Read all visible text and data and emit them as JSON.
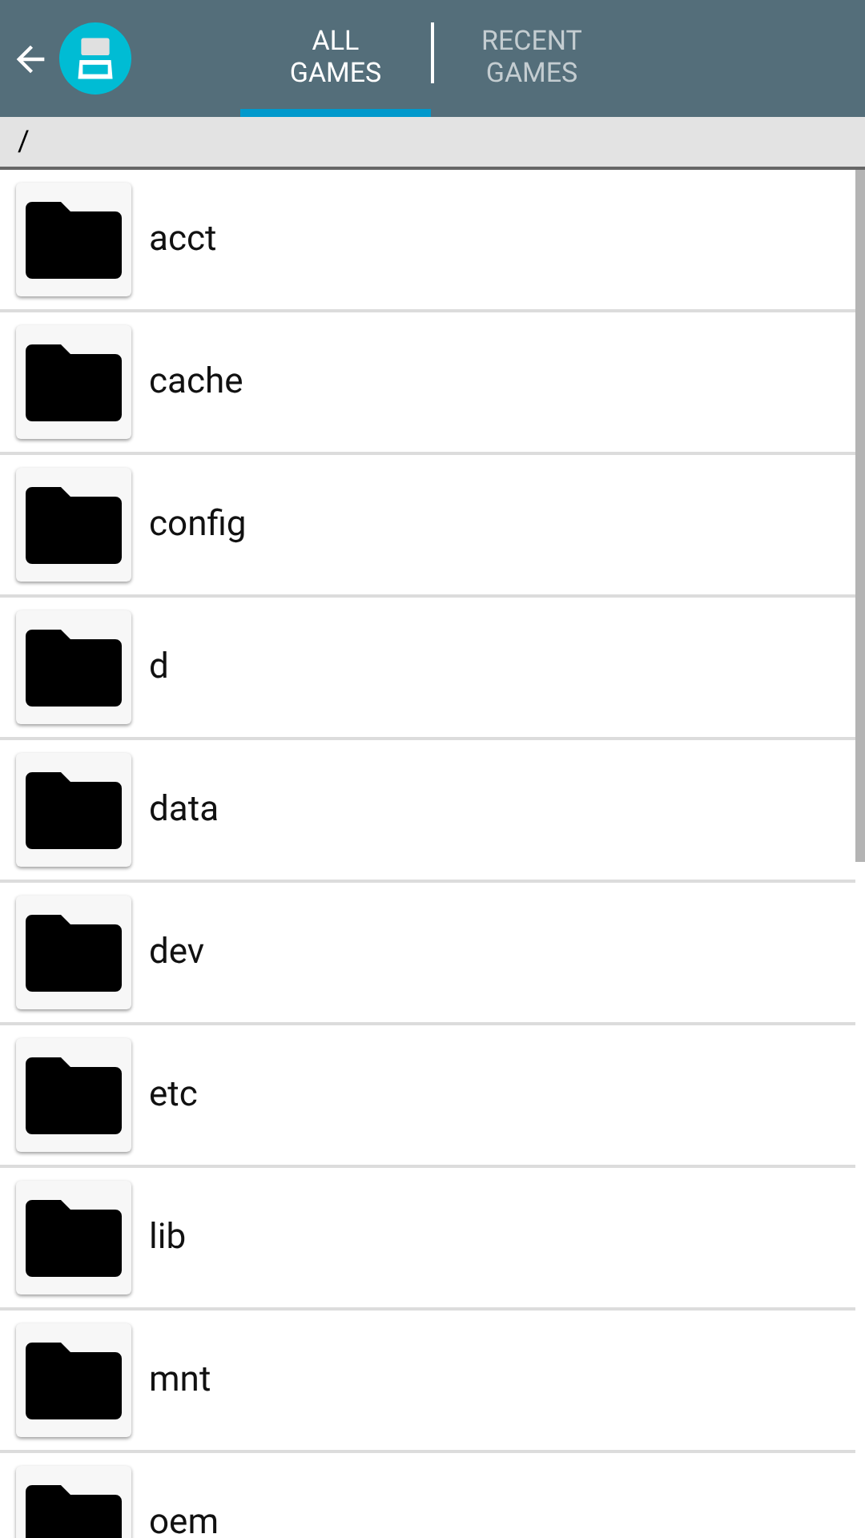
{
  "tabs": [
    {
      "label": "ALL GAMES",
      "selected": true
    },
    {
      "label": "RECENT GAMES",
      "selected": false
    }
  ],
  "path": "/",
  "files": [
    {
      "name": "acct"
    },
    {
      "name": "cache"
    },
    {
      "name": "config"
    },
    {
      "name": "d"
    },
    {
      "name": "data"
    },
    {
      "name": "dev"
    },
    {
      "name": "etc"
    },
    {
      "name": "lib"
    },
    {
      "name": "mnt"
    },
    {
      "name": "oem"
    }
  ]
}
